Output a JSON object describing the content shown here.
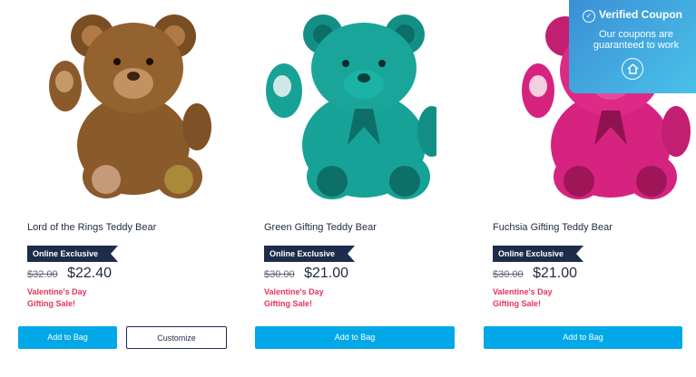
{
  "products": [
    {
      "name": "Lord of the Rings Teddy Bear",
      "badge": "Online Exclusive",
      "old_price": "$32.00",
      "new_price": "$22.40",
      "sale_line1": "Valentine's Day",
      "sale_line2": "Gifting Sale!",
      "add_label": "Add to Bag",
      "customize_label": "Customize"
    },
    {
      "name": "Green Gifting Teddy Bear",
      "badge": "Online Exclusive",
      "old_price": "$30.00",
      "new_price": "$21.00",
      "sale_line1": "Valentine's Day",
      "sale_line2": "Gifting Sale!",
      "add_label": "Add to Bag"
    },
    {
      "name": "Fuchsia Gifting Teddy Bear",
      "badge": "Online Exclusive",
      "old_price": "$30.00",
      "new_price": "$21.00",
      "sale_line1": "Valentine's Day",
      "sale_line2": "Gifting Sale!",
      "add_label": "Add to Bag"
    }
  ],
  "coupon": {
    "title": "Verified Coupon",
    "line1": "Our coupons are",
    "line2": "guaranteed to work",
    "icon": "house-icon"
  },
  "colors": {
    "brown_bear": "#8a5a2b",
    "green_bear": "#1aa59b",
    "fuchsia_bear": "#d6237f",
    "button": "#00a8e8",
    "badge": "#1d2c4a",
    "sale": "#e8335a"
  }
}
